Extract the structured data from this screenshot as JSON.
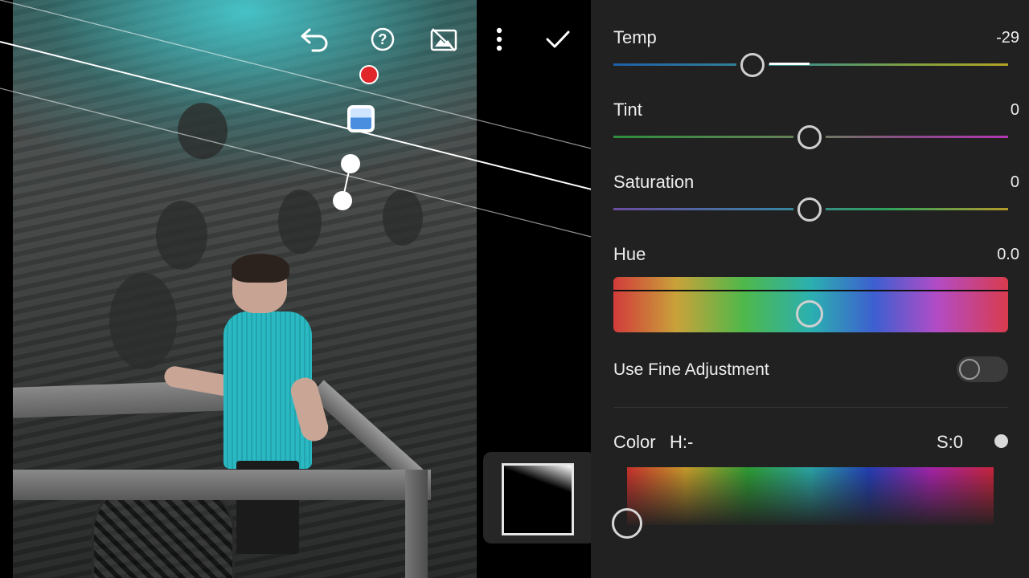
{
  "toolbar": {
    "undo_icon": "undo-icon",
    "help_icon": "help-icon",
    "mask_toggle_icon": "mask-visibility-off-icon",
    "more_icon": "more-vertical-icon",
    "done_icon": "checkmark-icon"
  },
  "panel": {
    "temp": {
      "label": "Temp",
      "value": "-29",
      "level": -29
    },
    "tint": {
      "label": "Tint",
      "value": "0",
      "level": 0
    },
    "saturation": {
      "label": "Saturation",
      "value": "0",
      "level": 0
    },
    "hue": {
      "label": "Hue",
      "value": "0.0",
      "level": 0.0
    },
    "fine_adjustment": {
      "label": "Use Fine Adjustment",
      "enabled": false
    },
    "color": {
      "label": "Color",
      "h_label": "H:-",
      "s_label": "S:0"
    }
  },
  "colors": {
    "panel_bg": "#212121",
    "accent_red": "#e0262a",
    "mask_blue": "#4a8ee0"
  }
}
